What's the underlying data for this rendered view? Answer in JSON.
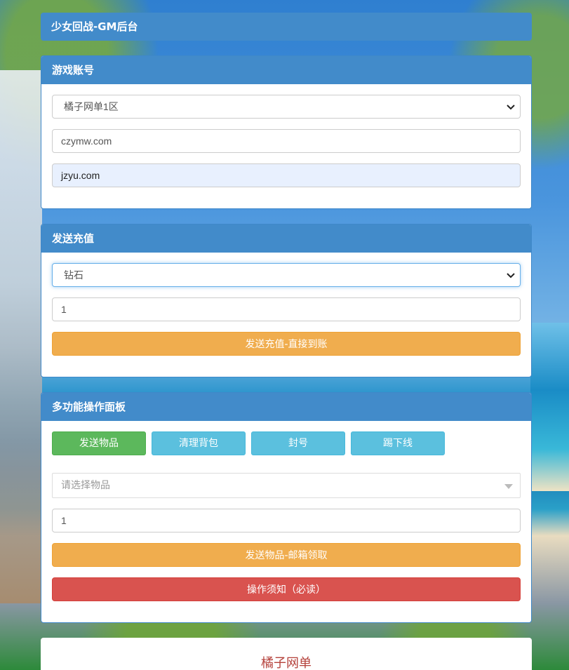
{
  "header": {
    "title": "少女回战-GM后台"
  },
  "account_panel": {
    "heading": "游戏账号",
    "server_select": "橘子网单1区",
    "account_value": "czymw.com",
    "password_value": "jzyu.com"
  },
  "recharge_panel": {
    "heading": "发送充值",
    "type_select": "钻石",
    "amount_value": "1",
    "submit_label": "发送充值-直接到账"
  },
  "multi_panel": {
    "heading": "多功能操作面板",
    "tabs": [
      {
        "label": "发送物品"
      },
      {
        "label": "清理背包"
      },
      {
        "label": "封号"
      },
      {
        "label": "踢下线"
      }
    ],
    "item_placeholder": "请选择物品",
    "quantity_value": "1",
    "send_label": "发送物品-邮箱领取",
    "notice_label": "操作须知（必读）"
  },
  "footer": {
    "text": "橘子网单"
  },
  "colors": {
    "primary": "#428bca",
    "success": "#5cb85c",
    "info": "#5bc0de",
    "warning": "#f0ad4e",
    "danger": "#d9534f"
  },
  "icons": {
    "select_arrow": "chevron-down-icon",
    "dropdown_arrow": "triangle-down-icon"
  }
}
